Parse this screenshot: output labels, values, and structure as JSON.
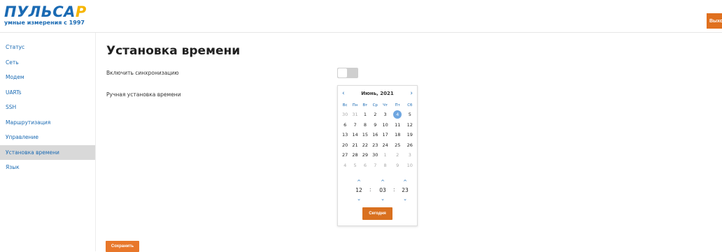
{
  "header": {
    "logo_text_main": "ПУЛЬСА",
    "logo_text_accent": "Р",
    "logo_tagline": "умные измерения с 1997",
    "exit_label": "Выход",
    "accent_color": "#e0701e",
    "brand_color": "#1a6ab3"
  },
  "sidebar": {
    "items": [
      {
        "label": "Статус"
      },
      {
        "label": "Сеть"
      },
      {
        "label": "Модем"
      },
      {
        "label": "UARTs"
      },
      {
        "label": "SSH"
      },
      {
        "label": "Маршрутизация"
      },
      {
        "label": "Управление"
      },
      {
        "label": "Установка времени",
        "active": true
      },
      {
        "label": "Язык"
      }
    ]
  },
  "main": {
    "title": "Установка времени",
    "sync_label": "Включить синхронизацию",
    "sync_enabled": false,
    "manual_label": "Ручная установка времени",
    "save_label": "Сохранить"
  },
  "datepicker": {
    "month_title": "Июнь, 2021",
    "prev_icon": "‹",
    "next_icon": "›",
    "weekdays": [
      "Вс",
      "Пн",
      "Вт",
      "Ср",
      "Чт",
      "Пт",
      "Сб"
    ],
    "weeks": [
      [
        "30",
        "31",
        "1",
        "2",
        "3",
        "4",
        "5"
      ],
      [
        "6",
        "7",
        "8",
        "9",
        "10",
        "11",
        "12"
      ],
      [
        "13",
        "14",
        "15",
        "16",
        "17",
        "18",
        "19"
      ],
      [
        "20",
        "21",
        "22",
        "23",
        "24",
        "25",
        "26"
      ],
      [
        "27",
        "28",
        "29",
        "30",
        "1",
        "2",
        "3"
      ],
      [
        "4",
        "5",
        "6",
        "7",
        "8",
        "9",
        "10"
      ]
    ],
    "muted": [
      [
        0,
        0
      ],
      [
        0,
        1
      ],
      [
        4,
        4
      ],
      [
        4,
        5
      ],
      [
        4,
        6
      ],
      [
        5,
        0
      ],
      [
        5,
        1
      ],
      [
        5,
        2
      ],
      [
        5,
        3
      ],
      [
        5,
        4
      ],
      [
        5,
        5
      ],
      [
        5,
        6
      ]
    ],
    "selected": [
      0,
      5
    ],
    "time": {
      "hours": "12",
      "minutes": "03",
      "seconds": "23",
      "separator": ":"
    },
    "up_icon": "^",
    "down_icon": "⌄",
    "today_label": "Сегодня",
    "selected_color": "#6ea6e0"
  }
}
